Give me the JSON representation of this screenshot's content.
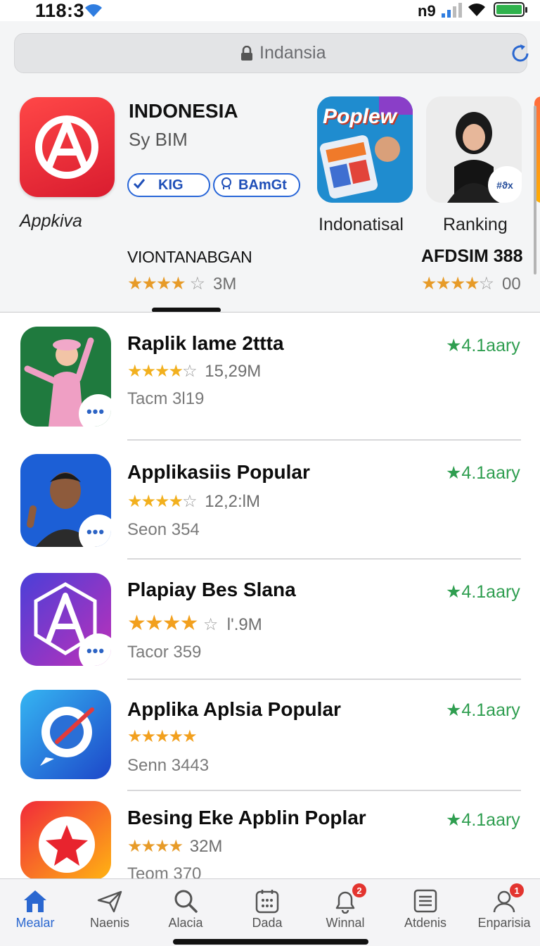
{
  "status_bar": {
    "time": "118:3",
    "carrier": "n9"
  },
  "search": {
    "text": "Indansia"
  },
  "featured": {
    "title": "INDONESIA",
    "subtitle": "Sy BIM",
    "badge1": "KIG",
    "badge2": "BAmGt",
    "app_name": "Appkiva",
    "tiles": [
      {
        "label": "Indonatisal",
        "art_text": "Poplew"
      },
      {
        "label": "Ranking",
        "tag": "#ϑx"
      }
    ],
    "section_left": {
      "title": "VIONTANABGAN",
      "rating_count": "3M"
    },
    "section_right": {
      "title": "AFDSIM 388",
      "rating_count": "00"
    }
  },
  "apps": [
    {
      "title": "Raplik lame 2ttta",
      "rating_count": "15,29M",
      "meta": "Tacm 3l19",
      "score": "4.1aary",
      "stars": 4
    },
    {
      "title": "Applikasiis Popular",
      "rating_count": "12,2:lM",
      "meta": "Seon 354",
      "score": "4.1aary",
      "stars": 4
    },
    {
      "title": "Plapiay Bes Slana",
      "rating_count": "l'.9M",
      "meta": "Tacor 359",
      "score": "4.1aary",
      "stars": 4
    },
    {
      "title": "Applika Aplsia Popular",
      "rating_count": "",
      "meta": "Senn 3443",
      "score": "4.1aary",
      "stars": 5
    },
    {
      "title": "Besing Eke Apblin Poplar",
      "rating_count": "32M",
      "meta": "Teom 370",
      "score": "4.1aary",
      "stars": 4
    }
  ],
  "tabs": [
    {
      "label": "Mealar",
      "icon": "home-icon",
      "active": true
    },
    {
      "label": "Naenis",
      "icon": "paper-plane-icon"
    },
    {
      "label": "Alacia",
      "icon": "search-icon"
    },
    {
      "label": "Dada",
      "icon": "calendar-icon"
    },
    {
      "label": "Winnal",
      "icon": "bell-icon",
      "badge": "2"
    },
    {
      "label": "Atdenis",
      "icon": "list-icon"
    },
    {
      "label": "Enparisia",
      "icon": "person-icon",
      "badge": "1"
    }
  ],
  "colors": {
    "accent": "#2a67d0",
    "score_green": "#2f9e50",
    "star": "#f2b01e"
  }
}
